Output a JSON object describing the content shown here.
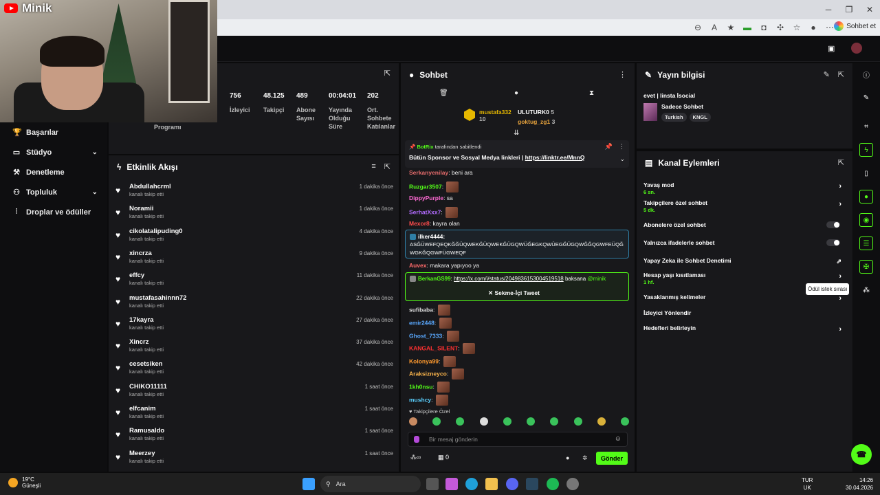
{
  "browser": {
    "sohbet_label": "Sohbet et",
    "window_controls": [
      "─",
      "❐",
      "✕"
    ]
  },
  "webcam": {
    "channel_name": "Minik"
  },
  "nav": {
    "items": [
      {
        "label": "Başarılar",
        "icon": "trophy-icon",
        "chevron": false
      },
      {
        "label": "Stüdyo",
        "icon": "studio-icon",
        "chevron": true
      },
      {
        "label": "Denetleme",
        "icon": "moderation-icon",
        "chevron": false
      },
      {
        "label": "Topluluk",
        "icon": "community-icon",
        "chevron": true
      },
      {
        "label": "Droplar ve ödüller",
        "icon": "drops-icon",
        "chevron": false
      }
    ]
  },
  "stats": {
    "partial_label": "Programı",
    "items": [
      {
        "value": "756",
        "label": "İzleyici"
      },
      {
        "value": "48.125",
        "label": "Takipçi"
      },
      {
        "value": "489",
        "label": "Abone Sayısı"
      },
      {
        "value": "00:04:01",
        "label": "Yayında Olduğu Süre"
      },
      {
        "value": "202",
        "label": "Ort. Sohbete Katılanlar"
      }
    ]
  },
  "activity": {
    "title": "Etkinlik Akışı",
    "items": [
      {
        "name": "Abdullahcrml",
        "sub": "kanalı takip etti",
        "time": "1 dakika önce"
      },
      {
        "name": "Noramii",
        "sub": "kanalı takip etti",
        "time": "1 dakika önce"
      },
      {
        "name": "cikolatalipuding0",
        "sub": "kanalı takip etti",
        "time": "4 dakika önce"
      },
      {
        "name": "xincrza",
        "sub": "kanalı takip etti",
        "time": "9 dakika önce"
      },
      {
        "name": "effcy",
        "sub": "kanalı takip etti",
        "time": "11 dakika önce"
      },
      {
        "name": "mustafasahinnn72",
        "sub": "kanalı takip etti",
        "time": "22 dakika önce"
      },
      {
        "name": "17kayra",
        "sub": "kanalı takip etti",
        "time": "27 dakika önce"
      },
      {
        "name": "Xincrz",
        "sub": "kanalı takip etti",
        "time": "37 dakika önce"
      },
      {
        "name": "cesetsiken",
        "sub": "kanalı takip etti",
        "time": "42 dakika önce"
      },
      {
        "name": "CHIKO11111",
        "sub": "kanalı takip etti",
        "time": "1 saat önce"
      },
      {
        "name": "elfcanim",
        "sub": "kanalı takip etti",
        "time": "1 saat önce"
      },
      {
        "name": "Ramusaldo",
        "sub": "kanalı takip etti",
        "time": "1 saat önce"
      },
      {
        "name": "Meerzey",
        "sub": "kanalı takip etti",
        "time": "1 saat önce"
      }
    ]
  },
  "chat": {
    "title": "Sohbet",
    "top_gifters": [
      {
        "name": "mustafa332",
        "count": "10"
      },
      {
        "name": "ULUTURK0",
        "count": "5"
      },
      {
        "name": "goktug_zg1",
        "count": "3"
      }
    ],
    "pinned": {
      "by": "BotRix",
      "by_suffix": "tarafından sabitlendi",
      "text": "Bütün Sponsor ve Sosyal Medya linkleri |",
      "link": "https://linktr.ee/MnnQ"
    },
    "messages": [
      {
        "user": "Serkanyenilay",
        "color": "#e46b6b",
        "text": "beni ara",
        "emote": false
      },
      {
        "user": "Ruzgar3507",
        "color": "#53fc18",
        "text": "",
        "emote": true
      },
      {
        "user": "DippyPurple",
        "color": "#ff6ad5",
        "text": "sa",
        "emote": false
      },
      {
        "user": "SerhatXxx7",
        "color": "#b26bff",
        "text": "",
        "emote": true
      },
      {
        "user": "Mexor8",
        "color": "#ff4c4c",
        "text": "kayra olan",
        "emote": false
      },
      {
        "user": "Auvex",
        "color": "#ff6a6a",
        "text": "makara yapıyoo ya",
        "emote": false
      },
      {
        "user": "sufibaba",
        "color": "#dddddd",
        "text": "",
        "emote": true
      },
      {
        "user": "emir2448",
        "color": "#5aa9ff",
        "text": "",
        "emote": true
      },
      {
        "user": "Ghost_7333",
        "color": "#5aa9ff",
        "text": "",
        "emote": true
      },
      {
        "user": "KANGAL_SILENT",
        "color": "#ff3030",
        "text": "",
        "emote": true
      },
      {
        "user": "Kolonya99",
        "color": "#ff9a2e",
        "text": "",
        "emote": true
      },
      {
        "user": "Araksizneyco",
        "color": "#ffb84d",
        "text": "",
        "emote": true
      },
      {
        "user": "1kh0nsu",
        "color": "#53fc18",
        "text": "",
        "emote": true
      },
      {
        "user": "mushcy",
        "color": "#5ad0ff",
        "text": "",
        "emote": true
      }
    ],
    "highlight1": {
      "user": "ilker4444",
      "text1": "ASĞÜWEFQEQKĞĞÜQWEKĞÜQWEKĞÜGQWÜĞEGKQWÜEGĞÜGQWĞĞQGWFEÜQĞ",
      "text2": "WGKĞQGWFÜGWEQF"
    },
    "highlight2": {
      "user": "BerkanGS99",
      "link": "https://x.com/i/status/2049836153004519518",
      "text": "baksana",
      "mention": "@minik",
      "tweet_btn": "Sekme-İçi Tweet"
    },
    "followers_only": "Takipçilere Özel",
    "input_placeholder": "Bir mesaj gönderin",
    "bottom_count": "0",
    "send_label": "Gönder"
  },
  "stream_info": {
    "title": "Yayın bilgisi",
    "stream_title": "evet | linsta İsocial",
    "category": "Sadece Sohbet",
    "tags": [
      "Turkish",
      "KNGL"
    ]
  },
  "channel_actions": {
    "title": "Kanal Eylemleri",
    "rows": [
      {
        "label": "Yavaş mod",
        "sub": "6 sn.",
        "control": "arrow"
      },
      {
        "label": "Takipçilere özel sohbet",
        "sub": "5 dk.",
        "control": "arrow"
      },
      {
        "label": "Abonelere özel sohbet",
        "sub": "",
        "control": "toggle"
      },
      {
        "label": "Yalnızca ifadelerle sohbet",
        "sub": "",
        "control": "toggle"
      },
      {
        "label": "Yapay Zeka ile Sohbet Denetimi",
        "sub": "",
        "control": "external"
      },
      {
        "label": "Hesap yaşı kısıtlaması",
        "sub": "1 hf.",
        "control": "arrow"
      },
      {
        "label": "Yasaklanmış kelimeler",
        "sub": "",
        "control": "arrow"
      },
      {
        "label": "İzleyici Yönlendir",
        "sub": "",
        "control": "none"
      },
      {
        "label": "Hedefleri belirleyin",
        "sub": "",
        "control": "arrow"
      }
    ]
  },
  "tooltip": "Ödül istek sırası",
  "taskbar": {
    "temp": "19°C",
    "weather": "Güneşli",
    "search": "Ara",
    "lang1": "TUR",
    "lang2": "UK",
    "time": "14:26",
    "date": "30.04.2026"
  },
  "colors": {
    "accent": "#53fc18",
    "panel": "#18181b",
    "bg": "#0b0b0c"
  }
}
